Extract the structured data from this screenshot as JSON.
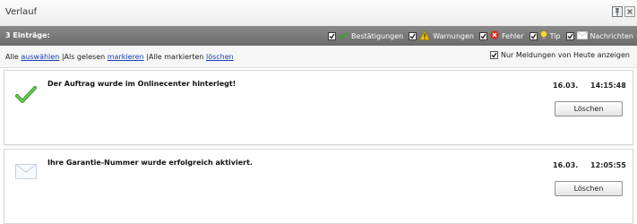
{
  "panel": {
    "title": "Verlauf"
  },
  "filter_bar": {
    "count_label": "3 Einträge:",
    "filters": [
      {
        "label": "Bestätigungen",
        "icon": "check-icon",
        "checked": true
      },
      {
        "label": "Warnungen",
        "icon": "warning-icon",
        "checked": true
      },
      {
        "label": "Fehler",
        "icon": "error-icon",
        "checked": true
      },
      {
        "label": "Tip",
        "icon": "lightbulb-icon",
        "checked": true
      },
      {
        "label": "Nachrichten",
        "icon": "envelope-icon",
        "checked": true
      }
    ]
  },
  "action_bar": {
    "prefix": "Alle",
    "select_link": "auswählen",
    "mark_read_text": "|Als gelesen",
    "mark_link": "markieren",
    "delete_marked_text": "|Alle markierten",
    "delete_link": "löschen",
    "today_only_label": "Nur Meldungen von Heute anzeigen",
    "today_only_checked": true
  },
  "messages": [
    {
      "icon": "checkmark-icon",
      "text": "Der Auftrag wurde im Onlinecenter hinterlegt!",
      "date": "16.03.",
      "time": "14:15:48",
      "delete_label": "Löschen"
    },
    {
      "icon": "envelope-icon",
      "text": "Ihre Garantie-Nummer wurde erfolgreich aktiviert.",
      "date": "16.03.",
      "time": "12:05:55",
      "delete_label": "Löschen"
    }
  ],
  "colors": {
    "filter_bar": "#7a7a7a",
    "link": "#1a3fb0",
    "check_green": "#3aa02a",
    "warning_yellow": "#f2c200",
    "error_red": "#d9261c"
  }
}
